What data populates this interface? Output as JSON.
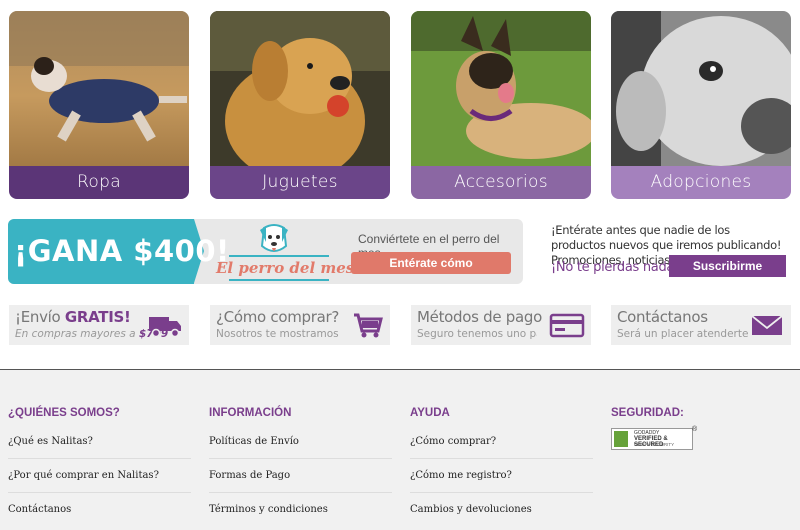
{
  "categories": [
    {
      "label": "Ropa",
      "color": "#5b3577"
    },
    {
      "label": "Juguetes",
      "color": "#6b4589"
    },
    {
      "label": "Accesorios",
      "color": "#8b67a3"
    },
    {
      "label": "Adopciones",
      "color": "#a481bd"
    }
  ],
  "promo": {
    "headline": "¡GANA $400!",
    "brand": "El perro del mes",
    "invite": "Conviértete en el perro del mes.",
    "cta": "Entérate cómo"
  },
  "newsletter": {
    "text": "¡Entérate antes que nadie de los productos nuevos que iremos publicando! Promociones, noticias y concursos.",
    "tagline": "¡No te pierdas nada!",
    "button": "Suscribirme"
  },
  "info_boxes": [
    {
      "title_pre": "¡Envío ",
      "title_bold": "GRATIS!",
      "sub_pre": "En compras mayores a ",
      "sub_bold": "$799",
      "icon": "truck-icon"
    },
    {
      "title_pre": "¿Cómo comprar?",
      "title_bold": "",
      "sub_pre": "Nosotros te mostramos",
      "sub_bold": "",
      "icon": "cart-icon"
    },
    {
      "title_pre": "Métodos de pago",
      "title_bold": "",
      "sub_pre": "Seguro tenemos uno para ti",
      "sub_bold": "",
      "icon": "credit-card-icon"
    },
    {
      "title_pre": "Contáctanos",
      "title_bold": "",
      "sub_pre": "Será un placer atenderte",
      "sub_bold": "",
      "icon": "envelope-icon"
    }
  ],
  "footer": {
    "columns": [
      {
        "heading": "¿QUIÉNES SOMOS?",
        "links": [
          "¿Qué es Nalitas?",
          "¿Por qué comprar en Nalitas?",
          "Contáctanos"
        ]
      },
      {
        "heading": "INFORMACIÓN",
        "links": [
          "Políticas de Envío",
          "Formas de Pago",
          "Términos y condiciones"
        ]
      },
      {
        "heading": "AYUDA",
        "links": [
          "¿Cómo comprar?",
          "¿Cómo me registro?",
          "Cambios y devoluciones"
        ]
      },
      {
        "heading": "SEGURIDAD:",
        "links": []
      }
    ],
    "badge": {
      "line1": "GODADDY",
      "line2": "VERIFIED & SECURED",
      "line3": "VERIFY SECURITY",
      "reg": "®"
    }
  },
  "colors": {
    "purple": "#7a3e8c",
    "teal": "#3ab3c3",
    "coral": "#e0796a"
  }
}
